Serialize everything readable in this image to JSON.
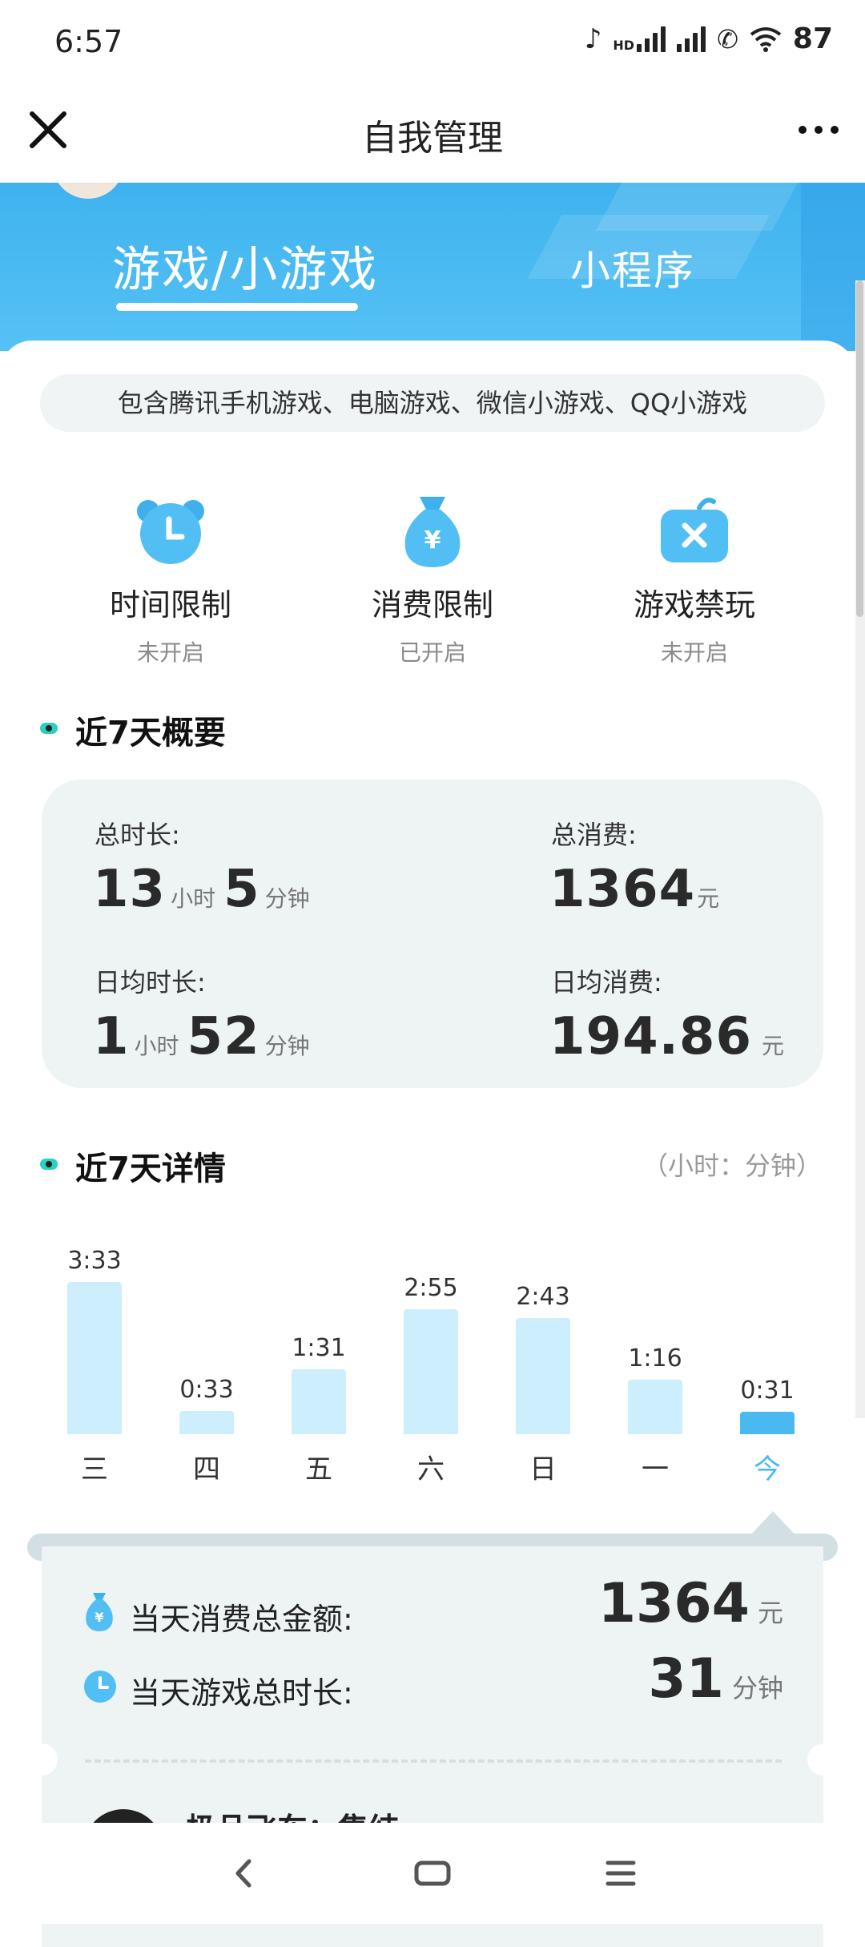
{
  "status": {
    "time": "6:57",
    "hd": "HD",
    "battery": "87"
  },
  "titlebar": {
    "title": "自我管理"
  },
  "tabs": {
    "games": "游戏/小游戏",
    "mini": "小程序"
  },
  "notice": "包含腾讯手机游戏、电脑游戏、微信小游戏、QQ小游戏",
  "limits": [
    {
      "label": "时间限制",
      "status": "未开启",
      "icon": "alarm-clock-icon"
    },
    {
      "label": "消费限制",
      "status": "已开启",
      "icon": "money-bag-icon"
    },
    {
      "label": "游戏禁玩",
      "status": "未开启",
      "icon": "game-ban-icon"
    }
  ],
  "summary": {
    "title": "近7天概要",
    "total_time_label": "总时长:",
    "total_hours": "13",
    "total_minutes": "5",
    "total_spend_label": "总消费:",
    "total_spend": "1364",
    "avg_time_label": "日均时长:",
    "avg_hours": "1",
    "avg_minutes": "52",
    "avg_spend_label": "日均消费:",
    "avg_spend": "194.86",
    "unit_hour": "小时",
    "unit_min": "分钟",
    "unit_yuan": "元"
  },
  "details": {
    "title": "近7天详情",
    "unit_note": "（小时：分钟）"
  },
  "chart_data": {
    "type": "bar",
    "categories": [
      "三",
      "四",
      "五",
      "六",
      "日",
      "一",
      "今"
    ],
    "labels": [
      "3:33",
      "0:33",
      "1:31",
      "2:55",
      "2:43",
      "1:16",
      "0:31"
    ],
    "values": [
      213,
      33,
      91,
      175,
      163,
      76,
      31
    ],
    "value_unit": "分钟",
    "highlight_index": 6,
    "colors": {
      "bar": "#cdeefd",
      "highlight": "#4ab9f1"
    }
  },
  "today": {
    "spend_label": "当天消费总金额:",
    "spend": "1364",
    "spend_unit": "元",
    "time_label": "当天游戏总时长:",
    "time": "31",
    "time_unit": "分钟",
    "game_name": "极品飞车：集结"
  },
  "colors": {
    "accent": "#3fb2ee",
    "card_bg": "#eef3f4"
  }
}
